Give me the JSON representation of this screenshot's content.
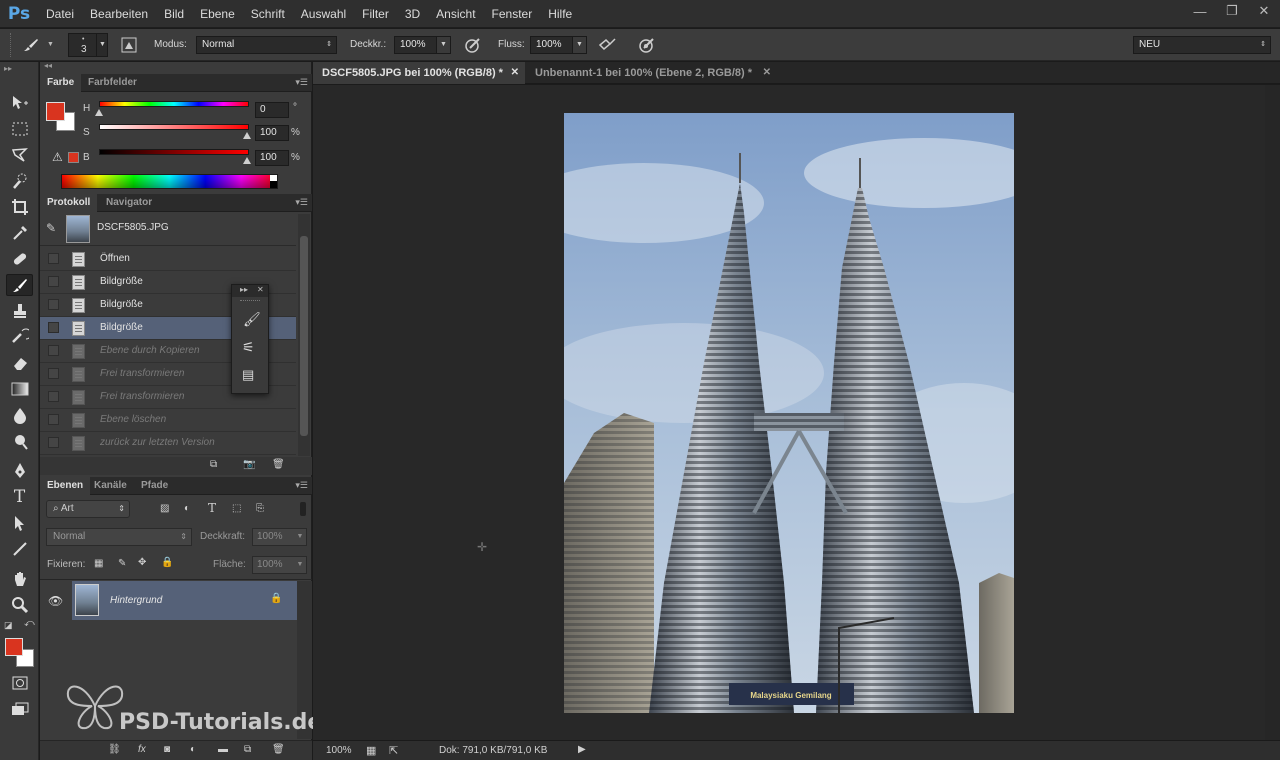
{
  "app": {
    "logo": "Ps"
  },
  "menu": [
    "Datei",
    "Bearbeiten",
    "Bild",
    "Ebene",
    "Schrift",
    "Auswahl",
    "Filter",
    "3D",
    "Ansicht",
    "Fenster",
    "Hilfe"
  ],
  "window_controls": {
    "minimize": "—",
    "restore": "❐",
    "close": "✕"
  },
  "options_bar": {
    "brush_size": "3",
    "mode_label": "Modus:",
    "mode_value": "Normal",
    "opacity_label": "Deckkr.:",
    "opacity_value": "100%",
    "flow_label": "Fluss:",
    "flow_value": "100%",
    "workspace": "NEU"
  },
  "color_panel": {
    "tabs": [
      "Farbe",
      "Farbfelder"
    ],
    "foreground": "#d9341f",
    "background": "#ffffff",
    "h_label": "H",
    "h_value": "0",
    "h_unit": "°",
    "s_label": "S",
    "s_value": "100",
    "s_unit": "%",
    "b_label": "B",
    "b_value": "100",
    "b_unit": "%"
  },
  "history_panel": {
    "tabs": [
      "Protokoll",
      "Navigator"
    ],
    "snapshot": "DSCF5805.JPG",
    "items": [
      {
        "label": "Öffnen",
        "state": "normal"
      },
      {
        "label": "Bildgröße",
        "state": "normal"
      },
      {
        "label": "Bildgröße",
        "state": "normal"
      },
      {
        "label": "Bildgröße",
        "state": "selected"
      },
      {
        "label": "Ebene durch Kopieren",
        "state": "dim"
      },
      {
        "label": "Frei transformieren",
        "state": "dim"
      },
      {
        "label": "Frei transformieren",
        "state": "dim"
      },
      {
        "label": "Ebene löschen",
        "state": "dim"
      },
      {
        "label": "zurück zur letzten Version",
        "state": "dim"
      }
    ]
  },
  "layers_panel": {
    "tabs": [
      "Ebenen",
      "Kanäle",
      "Pfade"
    ],
    "filter_kind": "Art",
    "blend_mode": "Normal",
    "opacity_label": "Deckkraft:",
    "opacity_value": "100%",
    "lock_label": "Fixieren:",
    "fill_label": "Fläche:",
    "fill_value": "100%",
    "layers": [
      {
        "name": "Hintergrund",
        "locked": true,
        "visible": true
      }
    ]
  },
  "documents": {
    "tabs": [
      {
        "label": "DSCF5805.JPG bei 100% (RGB/8) *",
        "active": true
      },
      {
        "label": "Unbenannt-1 bei 100% (Ebene 2, RGB/8) *",
        "active": false
      }
    ],
    "banner_text": "Malaysiaku Gemilang"
  },
  "status_bar": {
    "zoom": "100%",
    "doc_info": "Dok: 791,0 KB/791,0 KB"
  },
  "watermark": "PSD-Tutorials.de"
}
